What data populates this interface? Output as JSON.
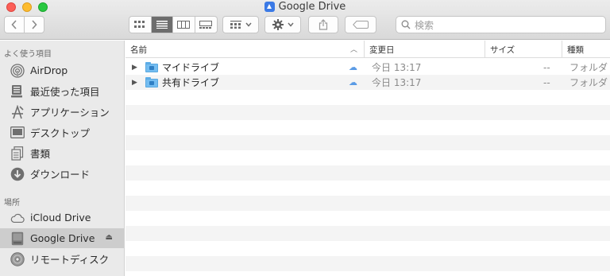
{
  "window": {
    "title": "Google Drive"
  },
  "toolbar": {
    "search_placeholder": "検索"
  },
  "sidebar": {
    "favorites_header": "よく使う項目",
    "places_header": "場所",
    "favorites": [
      {
        "label": "AirDrop",
        "icon": "airdrop-icon"
      },
      {
        "label": "最近使った項目",
        "icon": "recents-icon"
      },
      {
        "label": "アプリケーション",
        "icon": "applications-icon"
      },
      {
        "label": "デスクトップ",
        "icon": "desktop-icon"
      },
      {
        "label": "書類",
        "icon": "documents-icon"
      },
      {
        "label": "ダウンロード",
        "icon": "downloads-icon"
      }
    ],
    "places": [
      {
        "label": "iCloud Drive",
        "icon": "cloud-icon"
      },
      {
        "label": "Google Drive",
        "icon": "drive-icon",
        "selected": true
      },
      {
        "label": "リモートディスク",
        "icon": "disc-icon"
      }
    ]
  },
  "list": {
    "columns": {
      "name": "名前",
      "modified": "変更日",
      "size": "サイズ",
      "kind": "種類"
    },
    "rows": [
      {
        "name": "マイドライブ",
        "modified": "今日 13:17",
        "size": "--",
        "kind": "フォルダ"
      },
      {
        "name": "共有ドライブ",
        "modified": "今日 13:17",
        "size": "--",
        "kind": "フォルダ"
      }
    ]
  },
  "colors": {
    "sidebar_bg": "#eaeaea",
    "selected_bg": "#cdcdcd",
    "folder_blue": "#74bdf1",
    "close": "#fc5f57",
    "minimize": "#fdbc2e",
    "maximize": "#28c840"
  }
}
